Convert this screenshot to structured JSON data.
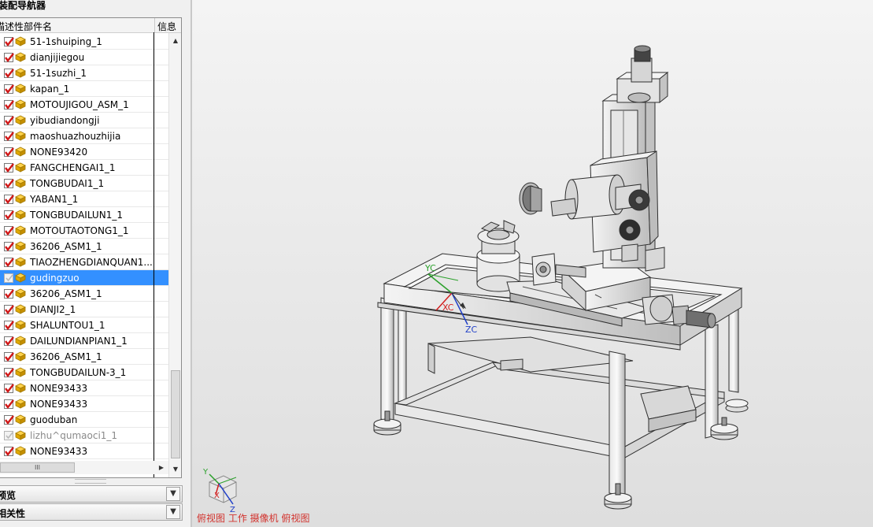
{
  "navigator": {
    "title": "装配导航器",
    "column_name": "描述性部件名",
    "column_info": "信息",
    "rows": [
      {
        "name": "51-1shuiping_1",
        "checked": true
      },
      {
        "name": "dianjijiegou",
        "checked": true
      },
      {
        "name": "51-1suzhi_1",
        "checked": true
      },
      {
        "name": "kapan_1",
        "checked": true
      },
      {
        "name": "MOTOUJIGOU_ASM_1",
        "checked": true
      },
      {
        "name": "yibudiandongji",
        "checked": true
      },
      {
        "name": "maoshuazhouzhijia",
        "checked": true
      },
      {
        "name": "NONE93420",
        "checked": true
      },
      {
        "name": "FANGCHENGAI1_1",
        "checked": true
      },
      {
        "name": "TONGBUDAI1_1",
        "checked": true
      },
      {
        "name": "YABAN1_1",
        "checked": true
      },
      {
        "name": "TONGBUDAILUN1_1",
        "checked": true
      },
      {
        "name": "MOTOUTAOTONG1_1",
        "checked": true
      },
      {
        "name": "36206_ASM1_1",
        "checked": true
      },
      {
        "name": "TIAOZHENGDIANQUAN1...",
        "checked": true
      },
      {
        "name": "gudingzuo",
        "checked": false,
        "selected": true
      },
      {
        "name": "36206_ASM1_1",
        "checked": true
      },
      {
        "name": "DIANJI2_1",
        "checked": true
      },
      {
        "name": "SHALUNTOU1_1",
        "checked": true
      },
      {
        "name": "DAILUNDIANPIAN1_1",
        "checked": true
      },
      {
        "name": "36206_ASM1_1",
        "checked": true
      },
      {
        "name": "TONGBUDAILUN-3_1",
        "checked": true
      },
      {
        "name": "NONE93433",
        "checked": true
      },
      {
        "name": "NONE93433",
        "checked": true
      },
      {
        "name": "guoduban",
        "checked": true
      },
      {
        "name": "lizhu^qumaoci1_1",
        "checked": false,
        "grey": true
      },
      {
        "name": "NONE93433",
        "checked": true
      }
    ],
    "hscroll_thumb": "III",
    "sections": [
      {
        "label": "预览"
      },
      {
        "label": "相关性"
      }
    ]
  },
  "viewport": {
    "triad_labels": {
      "yc": "YC",
      "xc": "XC",
      "zc": "ZC"
    },
    "mini_triad": {
      "y": "Y",
      "x": "X",
      "z": "Z"
    },
    "camera_bar": "俯视图 工作 摄像机 俯视图"
  },
  "colors": {
    "selection": "#3390ff",
    "check_red": "#d01818",
    "camera_text": "#d2322d"
  }
}
